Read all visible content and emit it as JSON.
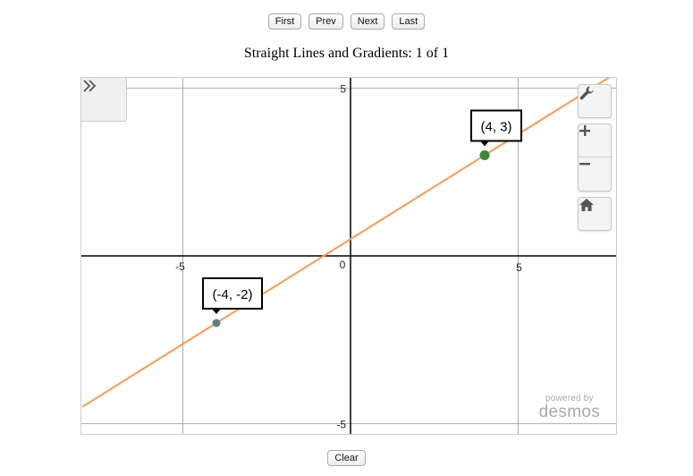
{
  "nav": {
    "first": "First",
    "prev": "Prev",
    "next": "Next",
    "last": "Last"
  },
  "title": "Straight Lines and Gradients: 1 of 1",
  "graph": {
    "x_range": [
      -8,
      8
    ],
    "y_range": [
      -8,
      8
    ],
    "ticks": {
      "x": [
        "-5",
        "0",
        "5"
      ],
      "y": [
        "5",
        "-5"
      ]
    },
    "line": {
      "slope": 0.625,
      "intercept": 0.5,
      "color": "#f5a060"
    },
    "points": [
      {
        "x": -4,
        "y": -2,
        "label": "(-4, -2)",
        "color": "#607d8b"
      },
      {
        "x": 4,
        "y": 3,
        "label": "(4, 3)",
        "color": "#3a8a3e"
      }
    ],
    "controls": {
      "expand_icon": "double-chevron-right-icon",
      "settings_icon": "wrench-icon",
      "zoom_in_icon": "plus-icon",
      "zoom_out_icon": "minus-icon",
      "home_icon": "home-icon"
    },
    "branding": {
      "small": "powered by",
      "big": "desmos"
    }
  },
  "footer": {
    "clear": "Clear"
  }
}
